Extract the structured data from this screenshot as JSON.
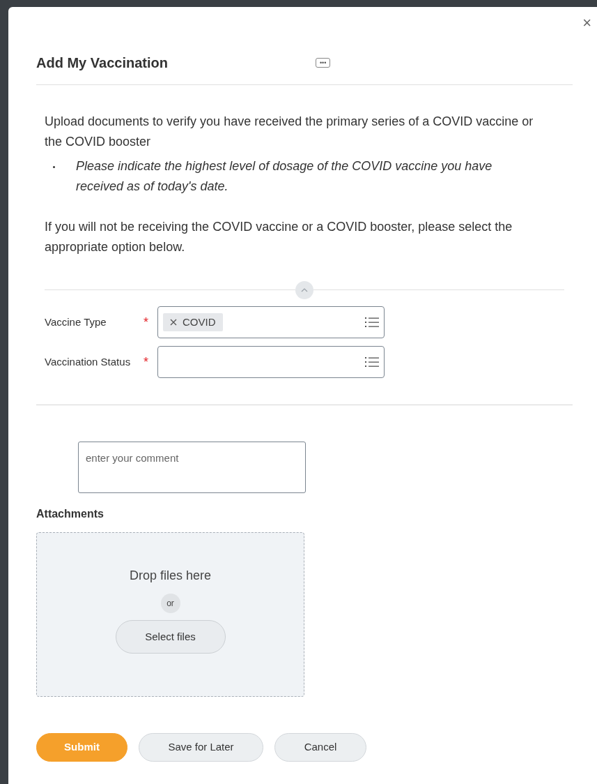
{
  "dialog": {
    "title": "Add My Vaccination",
    "more_button": "•••",
    "close_button": "×"
  },
  "instructions": [
    {
      "kind": "paragraph",
      "text": "Upload documents to verify you have received the primary series of a COVID vaccine or the COVID booster"
    },
    {
      "kind": "bullet",
      "text": "Please indicate the highest level of dosage of the COVID vaccine you have received as of today's date."
    },
    {
      "kind": "paragraph",
      "text": "If you will not be receiving the COVID vaccine or a COVID booster, please select the appropriate option below."
    }
  ],
  "section": {
    "expanded": true
  },
  "fields": [
    {
      "label": "Vaccine Type",
      "required_mark": "*",
      "chips": [
        "COVID"
      ]
    },
    {
      "label": "Vaccination Status",
      "required_mark": "*"
    }
  ],
  "comment": {
    "placeholder": "enter your comment"
  },
  "attachments": {
    "heading": "Attachments",
    "drop_text": "Drop files here",
    "or": "or",
    "button": "Select files"
  },
  "buttons": [
    {
      "label": "Submit",
      "kind": "primary"
    },
    {
      "label": "Save for Later",
      "kind": "secondary"
    },
    {
      "label": "Cancel",
      "kind": "secondary"
    }
  ]
}
